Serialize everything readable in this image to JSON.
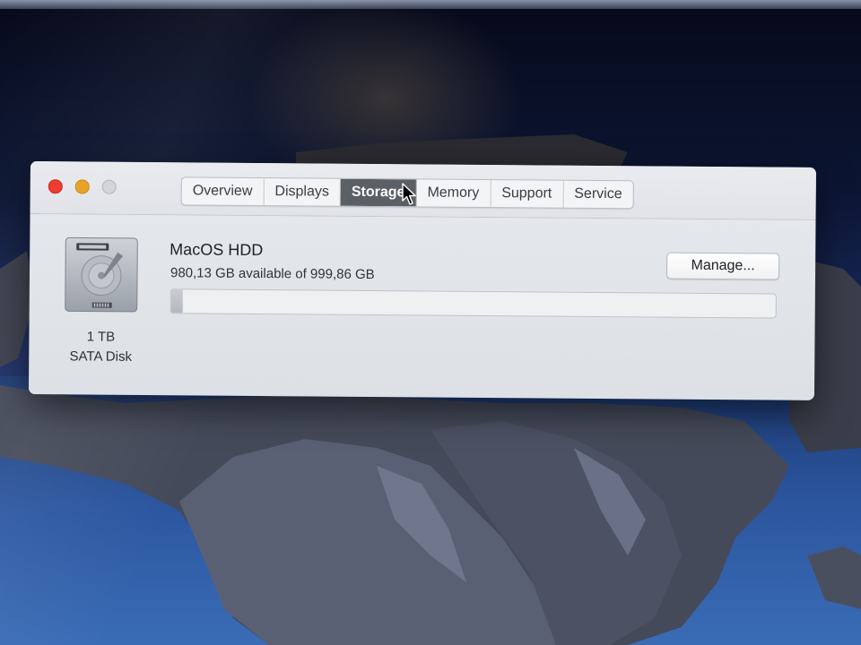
{
  "window": {
    "tabs": [
      {
        "label": "Overview",
        "active": false
      },
      {
        "label": "Displays",
        "active": false
      },
      {
        "label": "Storage",
        "active": true
      },
      {
        "label": "Memory",
        "active": false
      },
      {
        "label": "Support",
        "active": false
      },
      {
        "label": "Service",
        "active": false
      }
    ]
  },
  "storage": {
    "disk_size": "1 TB",
    "disk_type": "SATA Disk",
    "volume_name": "MacOS HDD",
    "availability": "980,13 GB available of 999,86 GB",
    "used_fraction": 0.0197,
    "manage_label": "Manage..."
  },
  "colors": {
    "close": "#ee3b33",
    "minimize": "#eaa32a",
    "zoom_disabled": "#d2d4d8",
    "active_tab": "#5b5f66"
  },
  "icons": {
    "disk": "hard-drive-icon",
    "cursor": "arrow-pointer-icon"
  }
}
